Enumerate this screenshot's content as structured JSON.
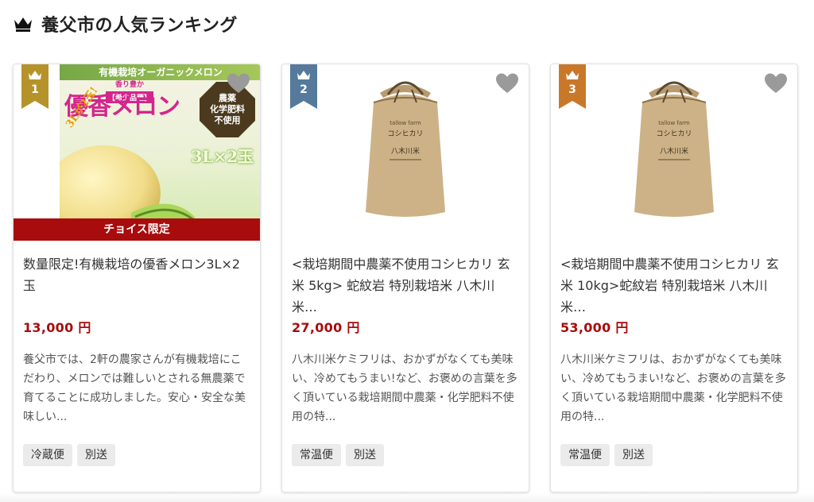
{
  "header": {
    "title": "養父市の人気ランキング",
    "icon": "crown-icon"
  },
  "colors": {
    "gold": "#b6932a",
    "silver": "#557a9c",
    "bronze": "#c9782a",
    "price": "#a80c0c",
    "choice_band": "#a80c0c",
    "favorite_icon": "#9a9a9a"
  },
  "cards": [
    {
      "rank": "1",
      "rank_color": "gold",
      "image": {
        "banner_top": "有機栽培オーガニックメロン",
        "banner_main": "優香メロン",
        "banner_label": "香り豊か",
        "banner_sub": "【希少品種】",
        "banner_tilted": "3Lが2玉!",
        "banner_badge_lines": [
          "農薬",
          "化学肥料",
          "不使用"
        ],
        "banner_qty": "3L×2玉"
      },
      "choice_label": "チョイス限定",
      "title": "数量限定!有機栽培の優香メロン3L×2玉",
      "price": "13,000 円",
      "description": "養父市では、2軒の農家さんが有機栽培にこだわり、メロンでは難しいとされる無農薬で育てることに成功しました。安心・安全な美味しい...",
      "tags": [
        "冷蔵便",
        "別送"
      ]
    },
    {
      "rank": "2",
      "rank_color": "silver",
      "image": {
        "bag_brand": "tallow farm",
        "bag_name": "コシヒカリ",
        "bag_mark": "八木川米"
      },
      "title": "<栽培期間中農薬不使用コシヒカリ 玄米 5kg> 蛇紋岩 特別栽培米 八木川米…",
      "price": "27,000 円",
      "description": "八木川米ケミフリは、おかずがなくても美味い、冷めてもうまい!など、お褒めの言葉を多く頂いている栽培期間中農薬・化学肥料不使用の特...",
      "tags": [
        "常温便",
        "別送"
      ]
    },
    {
      "rank": "3",
      "rank_color": "bronze",
      "image": {
        "bag_brand": "tallow farm",
        "bag_name": "コシヒカリ",
        "bag_mark": "八木川米"
      },
      "title": "<栽培期間中農薬不使用コシヒカリ 玄米 10kg>蛇紋岩 特別栽培米 八木川米…",
      "price": "53,000 円",
      "description": "八木川米ケミフリは、おかずがなくても美味い、冷めてもうまい!など、お褒めの言葉を多く頂いている栽培期間中農薬・化学肥料不使用の特...",
      "tags": [
        "常温便",
        "別送"
      ]
    }
  ]
}
